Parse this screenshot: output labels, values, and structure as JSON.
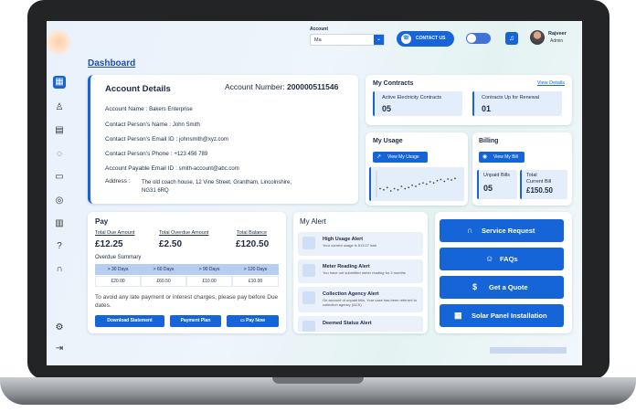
{
  "header": {
    "account_label": "Account",
    "account_value": "Ma",
    "contact_label": "CONTACT US",
    "user_name": "Rajveer",
    "user_role": "Admin"
  },
  "page_title": "Dashboard",
  "account_details": {
    "title": "Account Details",
    "account_number_label": "Account Number:",
    "account_number": "200000511546",
    "rows": [
      {
        "label": "Account Name :",
        "value": "Bakers Enterprise"
      },
      {
        "label": "Contact Person's Name :",
        "value": "John Smith"
      },
      {
        "label": "Contact Person's Email ID :",
        "value": "johnsmith@xyz.com"
      },
      {
        "label": "Contact Person's Phone :",
        "value": "+123 456 789"
      },
      {
        "label": "Account Payable Email ID :",
        "value": "smith-account@abc.com"
      }
    ],
    "address_label": "Address :",
    "address_value": "The old coach house, 12 Vine Street, Grantham, Lincolnshire, NG31 6RQ"
  },
  "contracts": {
    "title": "My Contracts",
    "link": "View Details",
    "active_label": "Active Electricity Contracts",
    "active_count": "05",
    "renewal_label": "Contracts Up for Renewal",
    "renewal_count": "01"
  },
  "usage": {
    "title": "My Usage",
    "button": "View My Usage",
    "sparkline": [
      0.3,
      0.25,
      0.35,
      0.2,
      0.3,
      0.25,
      0.4,
      0.3,
      0.35,
      0.45,
      0.4,
      0.5,
      0.55,
      0.5,
      0.6,
      0.55,
      0.65,
      0.7,
      0.62,
      0.72,
      0.68,
      0.75
    ]
  },
  "billing": {
    "title": "Billing",
    "button": "View My Bill",
    "unpaid_label": "Unpaid Bills",
    "unpaid_count": "05",
    "total_label_1": "Total",
    "total_label_2": "Current Bill",
    "total_value": "£150.50"
  },
  "pay": {
    "title": "Pay",
    "due_label": "Total Due Amount",
    "due_value": "£12.25",
    "overdue_label": "Total Overdue Amount",
    "overdue_value": "£2.50",
    "balance_label": "Total Balance",
    "balance_value": "£120.50",
    "summary_label": "Overdue Summary",
    "headers": [
      "> 30 Days",
      "> 60 Days",
      "> 90 Days",
      "> 120 Days"
    ],
    "values": [
      "£20.00",
      "£60.50",
      "£10.00",
      "£10.00"
    ],
    "note": "To avoid any late payment or interest charges, please pay before Due dates.",
    "btn_statement": "Download Statement",
    "btn_plan": "Payment Plan",
    "btn_pay": "Pay Now"
  },
  "alerts": {
    "title": "My Alert",
    "items": [
      {
        "title": "High Usage Alert",
        "desc": "Your current usage is 513.07 kwh"
      },
      {
        "title": "Meter Reading Alert",
        "desc": "You have not submitted meter reading for 2 months"
      },
      {
        "title": "Collection Agency Alert",
        "desc": "On account of unpaid bills, Your case has been referred to collection agency (ACS)"
      },
      {
        "title": "Deemed  Status Alert",
        "desc": ""
      }
    ]
  },
  "actions": {
    "service": "Service Request",
    "faqs": "FAQs",
    "quote": "Get a Quote",
    "solar": "Solar Panel Installation"
  },
  "colors": {
    "primary": "#1565d8",
    "card_tint": "#e4eefb"
  }
}
